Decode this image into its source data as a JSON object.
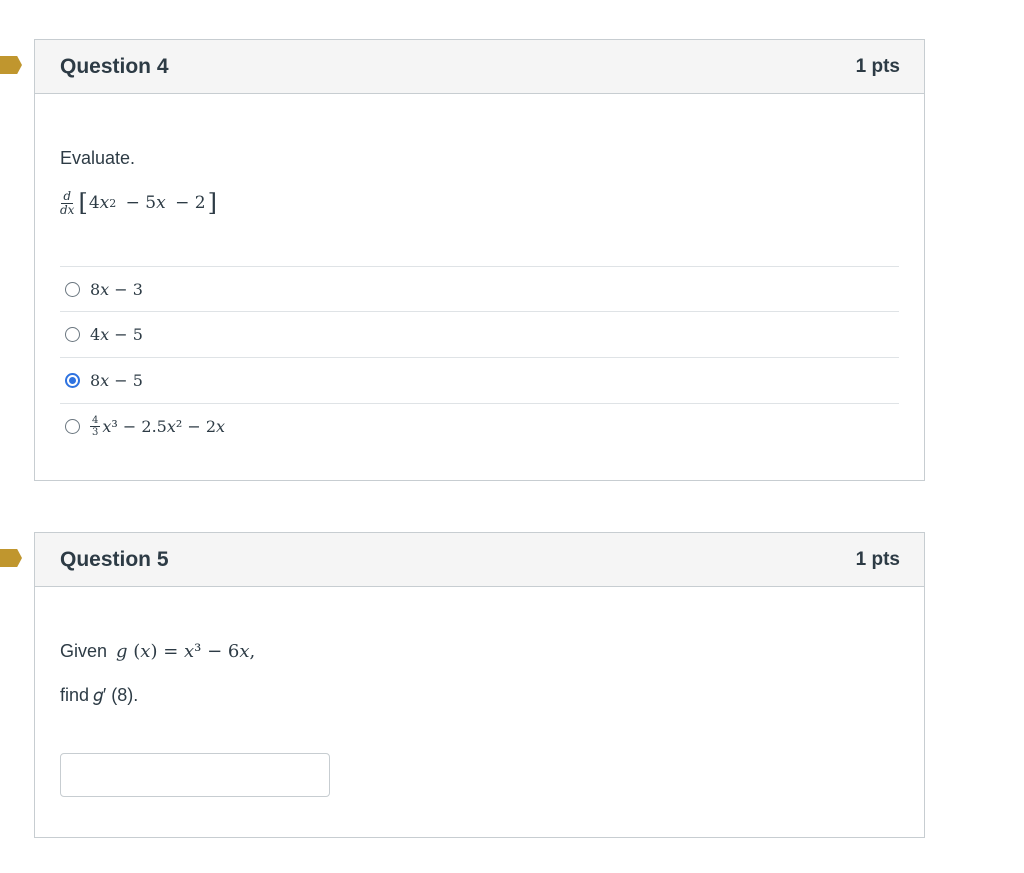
{
  "questions": [
    {
      "title": "Question 4",
      "points": "1 pts",
      "prompt": "Evaluate.",
      "expression": {
        "deriv_num": "d",
        "deriv_den": "dx",
        "open": "[",
        "body_a": "4",
        "var_x": "x",
        "exp2": "2",
        "body_b": " − 5",
        "body_c": " − 2",
        "close": "]"
      },
      "answers": [
        {
          "text": "8𝑥 − 3",
          "selected": false
        },
        {
          "text": "4𝑥 − 5",
          "selected": false
        },
        {
          "text": "8𝑥 − 5",
          "selected": true
        },
        {
          "frac_num": "4",
          "frac_den": "3",
          "rest": "𝑥³ − 2.5𝑥² − 2𝑥",
          "selected": false
        }
      ]
    },
    {
      "title": "Question 5",
      "points": "1 pts",
      "prompt_given": "Given",
      "given_expr": "𝑔 (𝑥) = 𝑥³ − 6𝑥,",
      "prompt_find": "find",
      "find_expr": "𝑔′ (8).",
      "answer_value": "",
      "answer_placeholder": ""
    }
  ],
  "colors": {
    "flag": "#c0962e",
    "selected_radio": "#2f73e0",
    "header_bg": "#f5f5f5",
    "border": "#c7cdd1"
  }
}
